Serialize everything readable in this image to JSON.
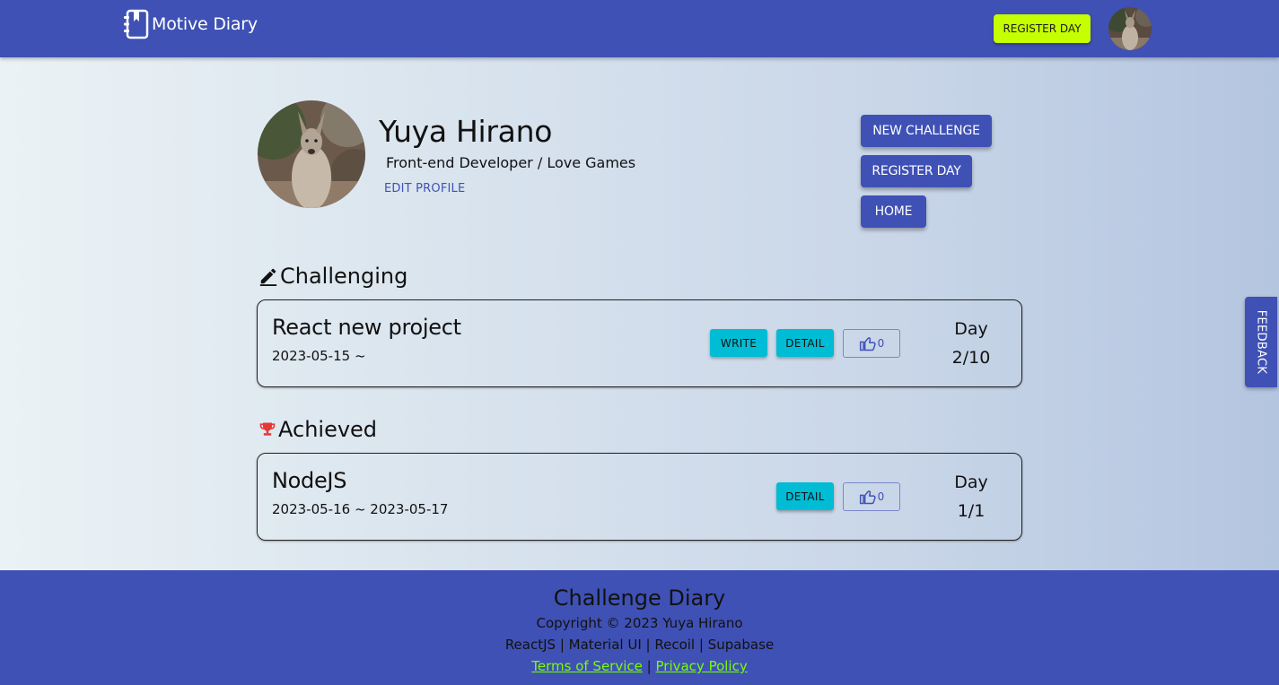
{
  "header": {
    "brand": "Motive Diary",
    "register_day": "REGISTER DAY"
  },
  "profile": {
    "name": "Yuya Hirano",
    "bio": "Front-end Developer / Love Games",
    "edit_profile": "EDIT PROFILE",
    "actions": {
      "new_challenge": "NEW CHALLENGE",
      "register_day": "REGISTER DAY",
      "home": "HOME"
    }
  },
  "sections": {
    "challenging": {
      "title": "Challenging",
      "items": [
        {
          "title": "React new project",
          "dates": "2023-05-15 ~",
          "write": "WRITE",
          "detail": "DETAIL",
          "likes": "0",
          "day_label": "Day",
          "day_count": "2/10"
        }
      ]
    },
    "achieved": {
      "title": "Achieved",
      "items": [
        {
          "title": "NodeJS",
          "dates": "2023-05-16 ~ 2023-05-17",
          "detail": "DETAIL",
          "likes": "0",
          "day_label": "Day",
          "day_count": "1/1"
        }
      ]
    }
  },
  "feedback": "FEEDBACK",
  "footer": {
    "title": "Challenge Diary",
    "copyright": "Copyright © 2023 Yuya Hirano",
    "stack": "ReactJS | Material UI | Recoil | Supabase",
    "terms": "Terms of Service",
    "separator": "|",
    "privacy": "Privacy Policy"
  },
  "colors": {
    "primary": "#3f51b5",
    "accent_lime": "#c6ff00",
    "cyan": "#00bcd4",
    "link_green": "#76ff03",
    "trophy_red": "#e53935"
  },
  "icons": {
    "brand": "diary-book-icon",
    "challenging": "pencil-icon",
    "achieved": "trophy-icon",
    "like": "thumb-up-icon"
  }
}
